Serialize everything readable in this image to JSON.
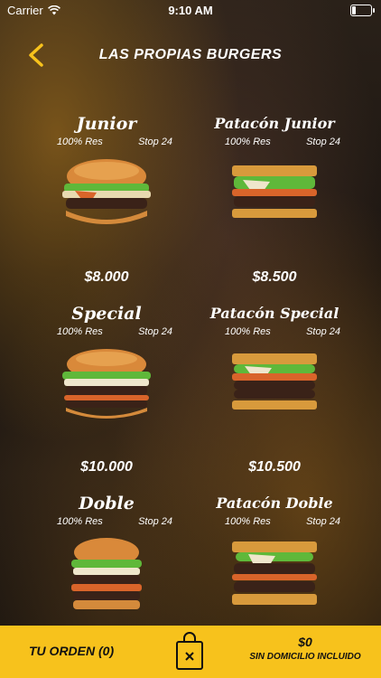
{
  "status_bar": {
    "carrier": "Carrier",
    "time": "9:10 AM"
  },
  "header": {
    "title": "LAS PROPIAS BURGERS"
  },
  "products": [
    {
      "name": "Junior",
      "meat": "100% Res",
      "stop": "Stop 24",
      "price": "$8.000"
    },
    {
      "name": "Patacón Junior",
      "meat": "100% Res",
      "stop": "Stop 24",
      "price": "$8.500"
    },
    {
      "name": "Special",
      "meat": "100% Res",
      "stop": "Stop 24",
      "price": "$10.000"
    },
    {
      "name": "Patacón Special",
      "meat": "100% Res",
      "stop": "Stop 24",
      "price": "$10.500"
    },
    {
      "name": "Doble",
      "meat": "100% Res",
      "stop": "Stop 24"
    },
    {
      "name": "Patacón Doble",
      "meat": "100% Res",
      "stop": "Stop 24"
    }
  ],
  "footer": {
    "order_label": "TU ORDEN (0)",
    "total": "$0",
    "delivery_note": "SIN DOMICILIO INCLUIDO"
  },
  "colors": {
    "accent": "#f7c21c",
    "background": "#1a1512"
  }
}
